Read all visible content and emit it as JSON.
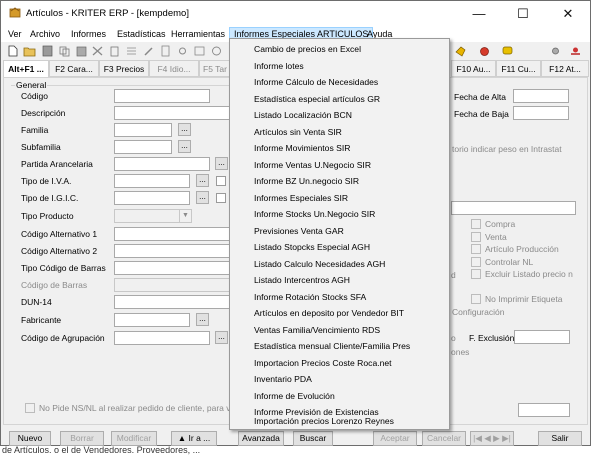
{
  "window": {
    "title": "Artículos - KRITER ERP - [kempdemo]"
  },
  "window_controls": {
    "minimize": "—",
    "maximize": "☐",
    "close": "✕"
  },
  "menubar": [
    "Ver",
    "Archivo",
    "Informes",
    "Estadísticas",
    "Herramientas",
    "Informes Especiales ARTICULOS",
    "Ayuda"
  ],
  "tabs": [
    "Alt+F1 ...",
    "F2 Cara...",
    "F3 Precios",
    "F4 Idio...",
    "F5 Tar",
    "F10 Au...",
    "F11 Cu...",
    "F12 At..."
  ],
  "general": {
    "group": "General",
    "labels": [
      "Código",
      "Descripción",
      "Familia",
      "Subfamilia",
      "Partida Arancelaria",
      "Tipo de I.V.A.",
      "Tipo de I.G.I.C.",
      "Tipo Producto",
      "Código Alternativo 1",
      "Código Alternativo 2",
      "Tipo Código de Barras",
      "Código de Barras",
      "DUN-14",
      "Fabricante",
      "Código de Agrupación"
    ],
    "right_labels": {
      "fecha_alta": "Fecha de Alta",
      "fecha_baja": "Fecha de Baja",
      "intrastat": "torio indicar peso en Intrastat",
      "f_exclusion": "F. Exclusión",
      "configuracion": "Configuración",
      "opciones": "ones",
      "d": "d",
      "o": "o"
    },
    "checkboxes": [
      "Compra",
      "Venta",
      "Artículo Producción",
      "Controlar NL",
      "Excluir Listado precio n",
      "No Imprimir Etiqueta"
    ],
    "bottom_check": "No Pide NS/NL al realizar pedido de cliente, para vinc"
  },
  "buttons": {
    "nuevo": "Nuevo",
    "borrar": "Borrar",
    "modificar": "Modificar",
    "ira": "▲ Ir a ...",
    "avanzada": "Avanzada",
    "buscar": "Buscar",
    "aceptar": "Aceptar",
    "cancelar": "Cancelar",
    "nav": "|◀ ◀ ▶ ▶|",
    "salir": "Salir"
  },
  "behind_text": "de Artículos. o el de Vendedores. Proveedores, ...",
  "dropdown_items": [
    "Cambio de precios en Excel",
    "Informe lotes",
    "Informe Cálculo de Necesidades",
    "Estadística especial artículos GR",
    "Listado Localización BCN",
    "Artículos sin Venta SIR",
    "Informe Movimientos SIR",
    "Informe Ventas U.Negocio SIR",
    "Informe BZ Un.negocio SIR",
    "Informes Especiales SIR",
    "Informe Stocks Un.Negocio SIR",
    "Previsiones Venta GAR",
    "Listado Stopcks Especial AGH",
    "Listado Calculo Necesidades AGH",
    "Listado Intercentros AGH",
    "Informe Rotación Stocks SFA",
    "Artículos en deposito por Vendedor BIT",
    "Ventas Familia/Vencimiento RDS",
    "Estadística mensual Cliente/Familia Pres",
    "Importacion Precios Coste Roca.net",
    "Inventario PDA",
    "Informe de Evolución",
    "Informe Previsión de Existencias",
    "Importación precios Lorenzo Reynes"
  ]
}
